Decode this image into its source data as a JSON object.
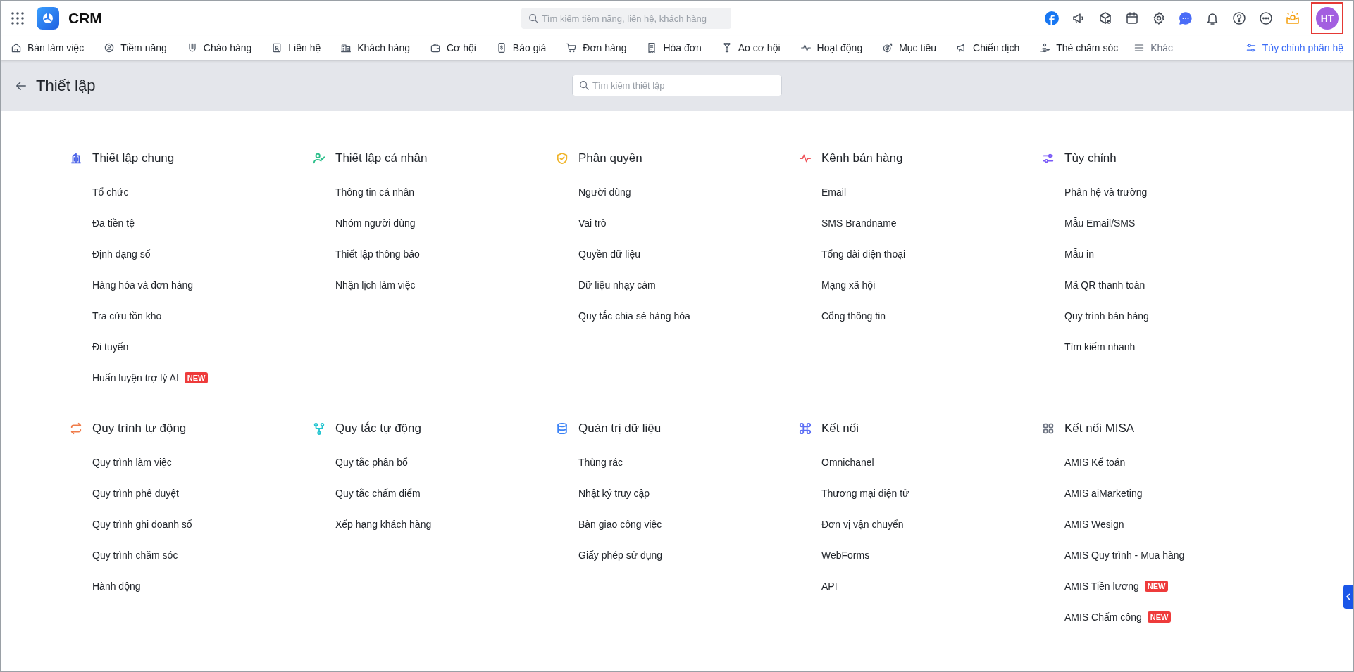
{
  "app": {
    "title": "CRM"
  },
  "search": {
    "placeholder": "Tìm kiếm tiềm năng, liên hệ, khách hàng"
  },
  "avatar": {
    "initials": "HT",
    "highlighted": true
  },
  "nav": {
    "items": [
      {
        "label": "Bàn làm việc"
      },
      {
        "label": "Tiềm năng"
      },
      {
        "label": "Chào hàng"
      },
      {
        "label": "Liên hệ"
      },
      {
        "label": "Khách hàng"
      },
      {
        "label": "Cơ hội"
      },
      {
        "label": "Báo giá"
      },
      {
        "label": "Đơn hàng"
      },
      {
        "label": "Hóa đơn"
      },
      {
        "label": "Ao cơ hội"
      },
      {
        "label": "Hoạt động"
      },
      {
        "label": "Mục tiêu"
      },
      {
        "label": "Chiến dịch"
      },
      {
        "label": "Thẻ chăm sóc"
      }
    ],
    "more": "Khác",
    "customize": "Tùy chỉnh phân hệ"
  },
  "page": {
    "title": "Thiết lập",
    "search_placeholder": "Tìm kiếm thiết lập"
  },
  "sections": [
    {
      "title": "Thiết lập chung",
      "color": "#4a62e8",
      "items": [
        {
          "label": "Tổ chức"
        },
        {
          "label": "Đa tiền tệ"
        },
        {
          "label": "Định dạng số"
        },
        {
          "label": "Hàng hóa và đơn hàng"
        },
        {
          "label": "Tra cứu tồn kho"
        },
        {
          "label": "Đi tuyến"
        },
        {
          "label": "Huấn luyện trợ lý AI",
          "badge": "NEW"
        }
      ]
    },
    {
      "title": "Thiết lập cá nhân",
      "color": "#2bbf8a",
      "items": [
        {
          "label": "Thông tin cá nhân"
        },
        {
          "label": "Nhóm người dùng"
        },
        {
          "label": "Thiết lập thông báo"
        },
        {
          "label": "Nhận lịch làm việc"
        }
      ]
    },
    {
      "title": "Phân quyền",
      "color": "#f0b429",
      "items": [
        {
          "label": "Người dùng"
        },
        {
          "label": "Vai trò"
        },
        {
          "label": "Quyền dữ liệu"
        },
        {
          "label": "Dữ liệu nhạy cảm"
        },
        {
          "label": "Quy tắc chia sẻ hàng hóa"
        }
      ]
    },
    {
      "title": "Kênh bán hàng",
      "color": "#f0575d",
      "items": [
        {
          "label": "Email"
        },
        {
          "label": "SMS Brandname"
        },
        {
          "label": "Tổng đài điện thoại"
        },
        {
          "label": "Mạng xã hội"
        },
        {
          "label": "Cổng thông tin"
        }
      ]
    },
    {
      "title": "Tùy chỉnh",
      "color": "#7a5af8",
      "items": [
        {
          "label": "Phân hệ và trường"
        },
        {
          "label": "Mẫu Email/SMS"
        },
        {
          "label": "Mẫu in"
        },
        {
          "label": "Mã QR thanh toán"
        },
        {
          "label": "Quy trình bán hàng"
        },
        {
          "label": "Tìm kiếm nhanh"
        }
      ]
    },
    {
      "title": "Quy trình tự động",
      "color": "#f07c4a",
      "items": [
        {
          "label": "Quy trình làm việc"
        },
        {
          "label": "Quy trình phê duyệt"
        },
        {
          "label": "Quy trình ghi doanh số"
        },
        {
          "label": "Quy trình chăm sóc"
        },
        {
          "label": "Hành động"
        }
      ]
    },
    {
      "title": "Quy tắc tự động",
      "color": "#22c5d0",
      "items": [
        {
          "label": "Quy tắc phân bổ"
        },
        {
          "label": "Quy tắc chấm điểm"
        },
        {
          "label": "Xếp hạng khách hàng"
        }
      ]
    },
    {
      "title": "Quản trị dữ liệu",
      "color": "#3b82f6",
      "items": [
        {
          "label": "Thùng rác"
        },
        {
          "label": "Nhật ký truy cập"
        },
        {
          "label": "Bàn giao công việc"
        },
        {
          "label": "Giấy phép sử dụng"
        }
      ]
    },
    {
      "title": "Kết nối",
      "color": "#5b6ef5",
      "items": [
        {
          "label": "Omnichanel"
        },
        {
          "label": "Thương mại điện tử"
        },
        {
          "label": "Đơn vị vận chuyển"
        },
        {
          "label": "WebForms"
        },
        {
          "label": "API"
        }
      ]
    },
    {
      "title": "Kết nối MISA",
      "color": "#6b7280",
      "items": [
        {
          "label": "AMIS Kế toán"
        },
        {
          "label": "AMIS aiMarketing"
        },
        {
          "label": "AMIS Wesign"
        },
        {
          "label": "AMIS Quy trình - Mua hàng"
        },
        {
          "label": "AMIS Tiền lương",
          "badge": "NEW"
        },
        {
          "label": "AMIS Chấm công",
          "badge": "NEW"
        }
      ]
    }
  ]
}
